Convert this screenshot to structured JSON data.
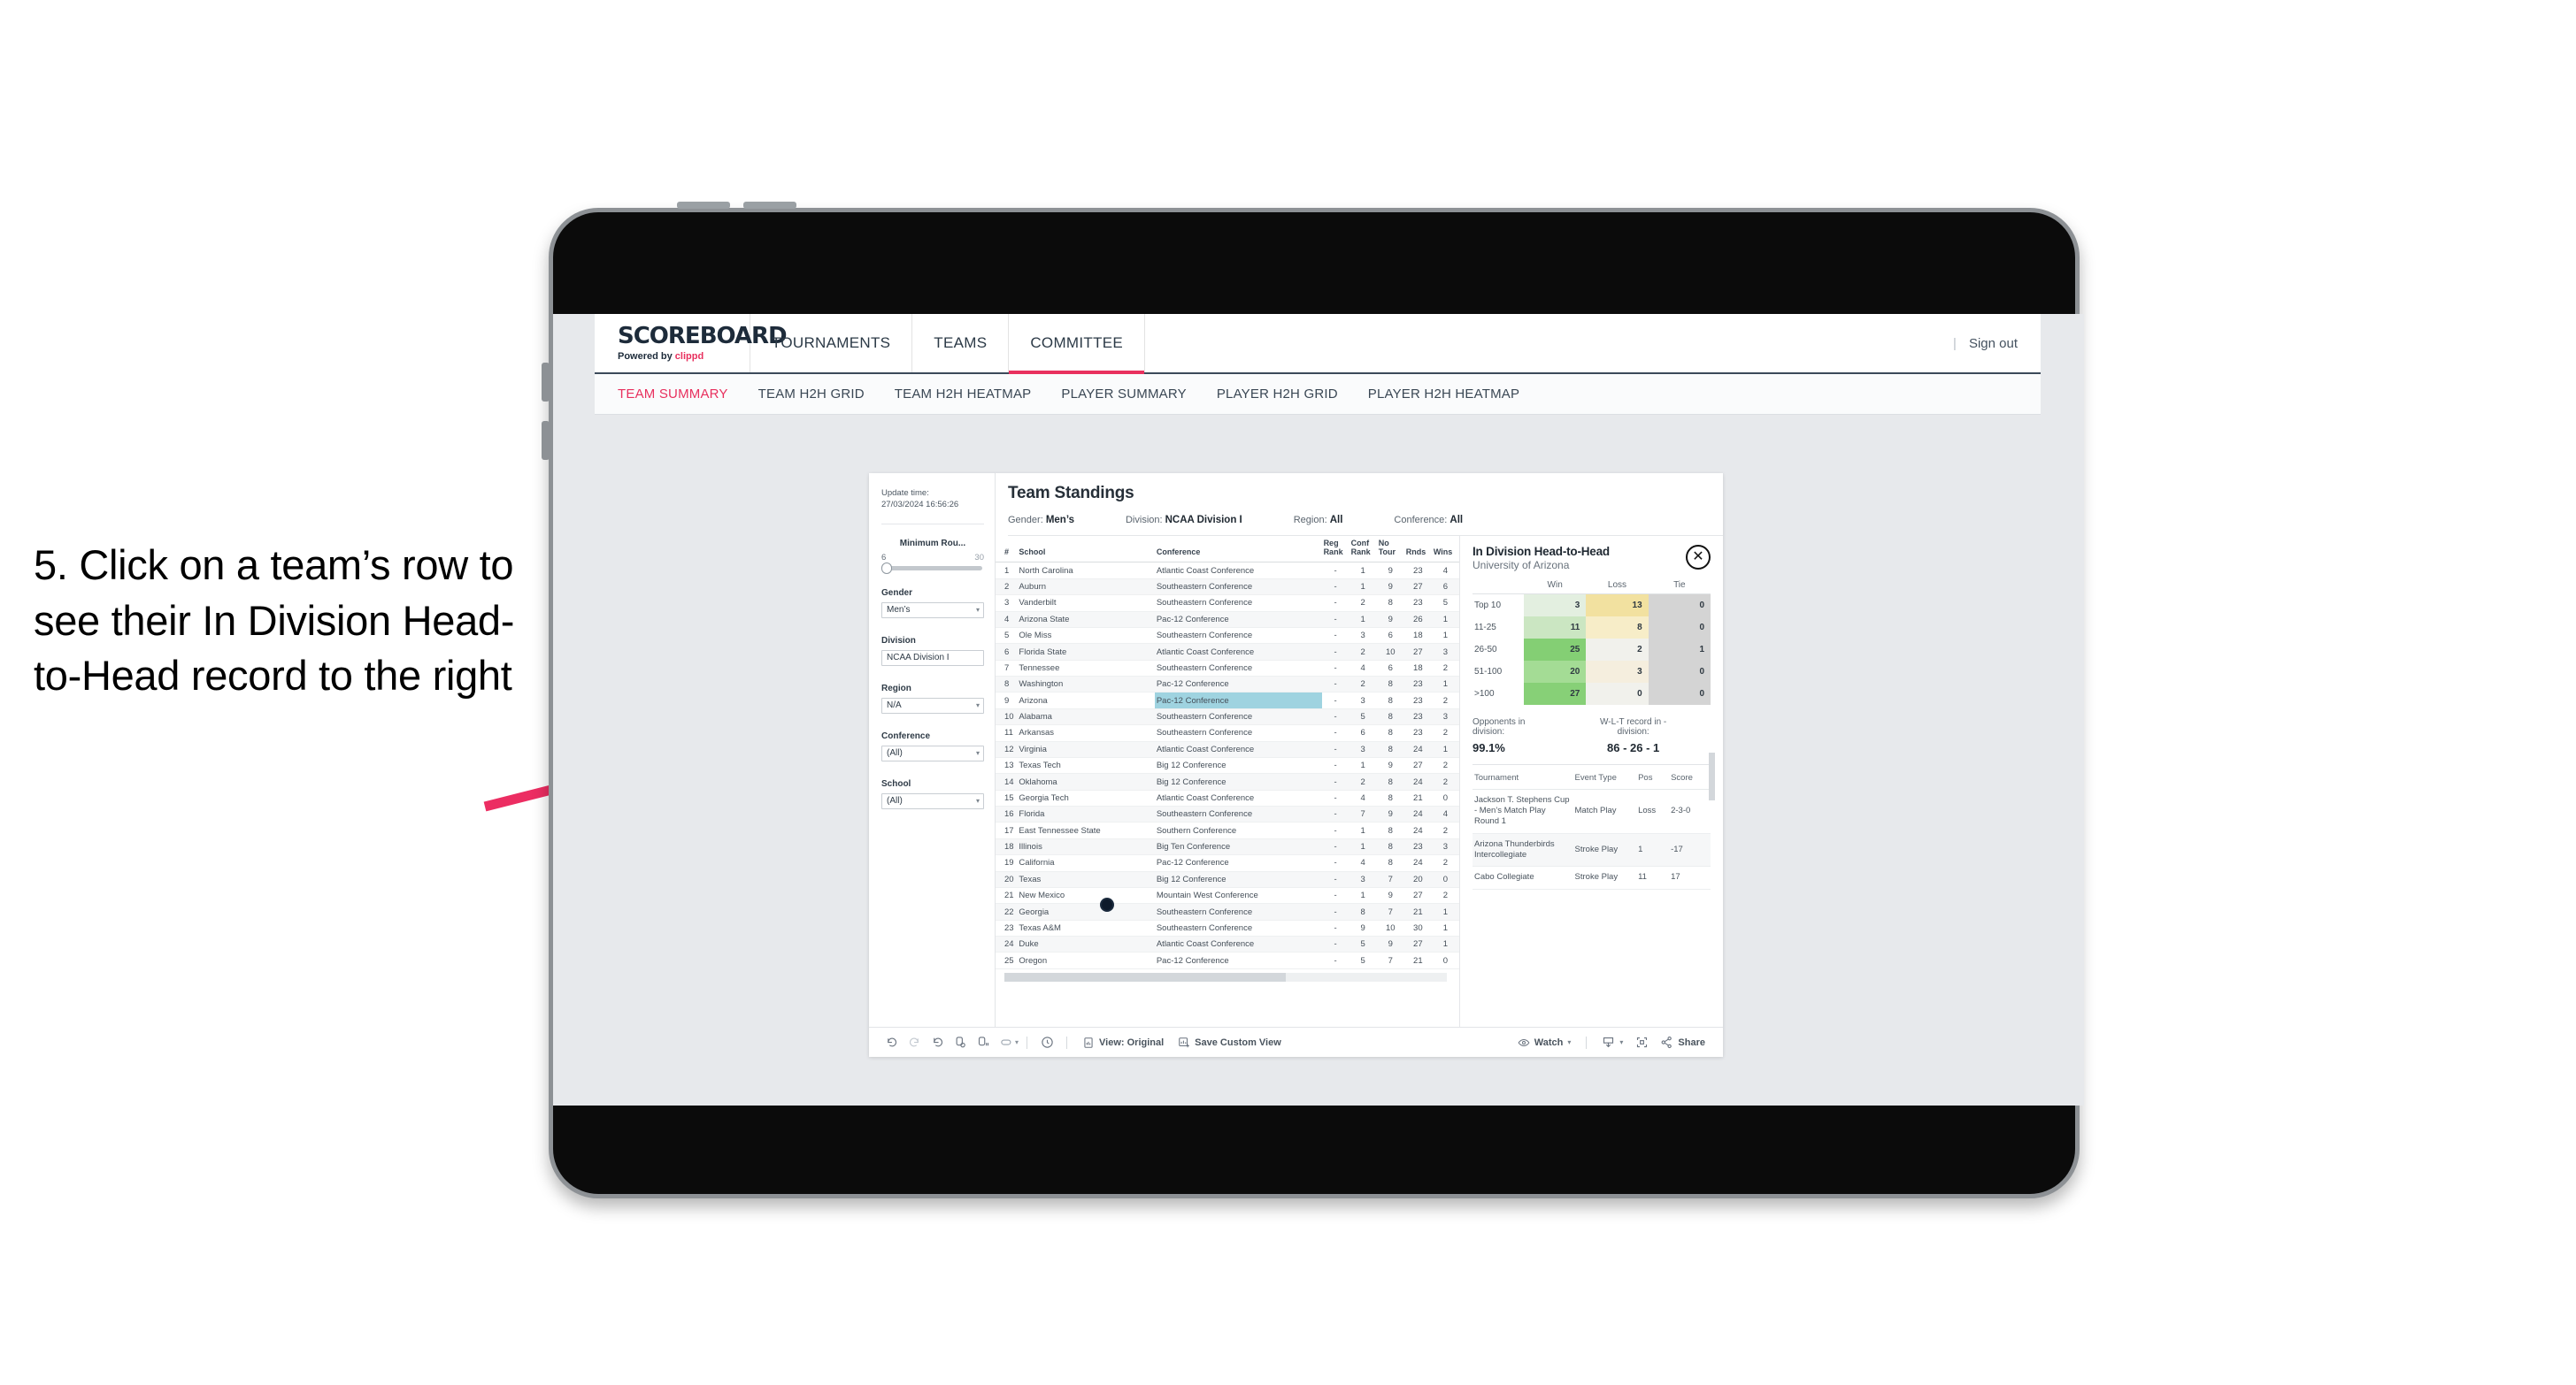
{
  "instruction": {
    "text": "5. Click on a team’s row to see their In Division Head-to-Head record to the right",
    "arrow_color": "#e8305e"
  },
  "topnav": {
    "brand_title": "SCOREBOARD",
    "brand_sub_prefix": "Powered by ",
    "brand_sub_name": "clippd",
    "items": [
      {
        "label": "TOURNAMENTS",
        "active": false
      },
      {
        "label": "TEAMS",
        "active": false
      },
      {
        "label": "COMMITTEE",
        "active": true
      }
    ],
    "divider": "|",
    "signout": "Sign out",
    "accent": "#e8305e"
  },
  "subtabs": [
    {
      "label": "TEAM SUMMARY",
      "active": true
    },
    {
      "label": "TEAM H2H GRID",
      "active": false
    },
    {
      "label": "TEAM H2H HEATMAP",
      "active": false
    },
    {
      "label": "PLAYER SUMMARY",
      "active": false
    },
    {
      "label": "PLAYER H2H GRID",
      "active": false
    },
    {
      "label": "PLAYER H2H HEATMAP",
      "active": false
    }
  ],
  "filters": {
    "update_label": "Update time:",
    "update_value": "27/03/2024 16:56:26",
    "min_rounds": {
      "label": "Minimum Rou...",
      "min": "6",
      "max": "30"
    },
    "gender": {
      "label": "Gender",
      "value": "Men’s"
    },
    "division": {
      "label": "Division",
      "value": "NCAA Division I"
    },
    "region": {
      "label": "Region",
      "value": "N/A"
    },
    "conference": {
      "label": "Conference",
      "value": "(All)"
    },
    "school": {
      "label": "School",
      "value": "(All)"
    }
  },
  "viz": {
    "title": "Team Standings",
    "filter_chips": [
      {
        "label": "Gender:",
        "value": "Men’s"
      },
      {
        "label": "Division:",
        "value": "NCAA Division I"
      },
      {
        "label": "Region:",
        "value": "All"
      },
      {
        "label": "Conference:",
        "value": "All"
      }
    ]
  },
  "standings": {
    "columns": [
      "#",
      "School",
      "Conference",
      "Reg Rank",
      "Conf Rank",
      "No Tour",
      "Rnds",
      "Wins"
    ],
    "selected_row": 9,
    "rows": [
      {
        "n": "1",
        "school": "North Carolina",
        "conf": "Atlantic Coast Conference",
        "reg": "-",
        "cr": "1",
        "nt": "9",
        "rnds": "23",
        "wins": "4"
      },
      {
        "n": "2",
        "school": "Auburn",
        "conf": "Southeastern Conference",
        "reg": "-",
        "cr": "1",
        "nt": "9",
        "rnds": "27",
        "wins": "6"
      },
      {
        "n": "3",
        "school": "Vanderbilt",
        "conf": "Southeastern Conference",
        "reg": "-",
        "cr": "2",
        "nt": "8",
        "rnds": "23",
        "wins": "5"
      },
      {
        "n": "4",
        "school": "Arizona State",
        "conf": "Pac-12 Conference",
        "reg": "-",
        "cr": "1",
        "nt": "9",
        "rnds": "26",
        "wins": "1"
      },
      {
        "n": "5",
        "school": "Ole Miss",
        "conf": "Southeastern Conference",
        "reg": "-",
        "cr": "3",
        "nt": "6",
        "rnds": "18",
        "wins": "1"
      },
      {
        "n": "6",
        "school": "Florida State",
        "conf": "Atlantic Coast Conference",
        "reg": "-",
        "cr": "2",
        "nt": "10",
        "rnds": "27",
        "wins": "3"
      },
      {
        "n": "7",
        "school": "Tennessee",
        "conf": "Southeastern Conference",
        "reg": "-",
        "cr": "4",
        "nt": "6",
        "rnds": "18",
        "wins": "2"
      },
      {
        "n": "8",
        "school": "Washington",
        "conf": "Pac-12 Conference",
        "reg": "-",
        "cr": "2",
        "nt": "8",
        "rnds": "23",
        "wins": "1"
      },
      {
        "n": "9",
        "school": "Arizona",
        "conf": "Pac-12 Conference",
        "reg": "-",
        "cr": "3",
        "nt": "8",
        "rnds": "23",
        "wins": "2"
      },
      {
        "n": "10",
        "school": "Alabama",
        "conf": "Southeastern Conference",
        "reg": "-",
        "cr": "5",
        "nt": "8",
        "rnds": "23",
        "wins": "3"
      },
      {
        "n": "11",
        "school": "Arkansas",
        "conf": "Southeastern Conference",
        "reg": "-",
        "cr": "6",
        "nt": "8",
        "rnds": "23",
        "wins": "2"
      },
      {
        "n": "12",
        "school": "Virginia",
        "conf": "Atlantic Coast Conference",
        "reg": "-",
        "cr": "3",
        "nt": "8",
        "rnds": "24",
        "wins": "1"
      },
      {
        "n": "13",
        "school": "Texas Tech",
        "conf": "Big 12 Conference",
        "reg": "-",
        "cr": "1",
        "nt": "9",
        "rnds": "27",
        "wins": "2"
      },
      {
        "n": "14",
        "school": "Oklahoma",
        "conf": "Big 12 Conference",
        "reg": "-",
        "cr": "2",
        "nt": "8",
        "rnds": "24",
        "wins": "2"
      },
      {
        "n": "15",
        "school": "Georgia Tech",
        "conf": "Atlantic Coast Conference",
        "reg": "-",
        "cr": "4",
        "nt": "8",
        "rnds": "21",
        "wins": "0"
      },
      {
        "n": "16",
        "school": "Florida",
        "conf": "Southeastern Conference",
        "reg": "-",
        "cr": "7",
        "nt": "9",
        "rnds": "24",
        "wins": "4"
      },
      {
        "n": "17",
        "school": "East Tennessee State",
        "conf": "Southern Conference",
        "reg": "-",
        "cr": "1",
        "nt": "8",
        "rnds": "24",
        "wins": "2"
      },
      {
        "n": "18",
        "school": "Illinois",
        "conf": "Big Ten Conference",
        "reg": "-",
        "cr": "1",
        "nt": "8",
        "rnds": "23",
        "wins": "3"
      },
      {
        "n": "19",
        "school": "California",
        "conf": "Pac-12 Conference",
        "reg": "-",
        "cr": "4",
        "nt": "8",
        "rnds": "24",
        "wins": "2"
      },
      {
        "n": "20",
        "school": "Texas",
        "conf": "Big 12 Conference",
        "reg": "-",
        "cr": "3",
        "nt": "7",
        "rnds": "20",
        "wins": "0"
      },
      {
        "n": "21",
        "school": "New Mexico",
        "conf": "Mountain West Conference",
        "reg": "-",
        "cr": "1",
        "nt": "9",
        "rnds": "27",
        "wins": "2"
      },
      {
        "n": "22",
        "school": "Georgia",
        "conf": "Southeastern Conference",
        "reg": "-",
        "cr": "8",
        "nt": "7",
        "rnds": "21",
        "wins": "1"
      },
      {
        "n": "23",
        "school": "Texas A&M",
        "conf": "Southeastern Conference",
        "reg": "-",
        "cr": "9",
        "nt": "10",
        "rnds": "30",
        "wins": "1"
      },
      {
        "n": "24",
        "school": "Duke",
        "conf": "Atlantic Coast Conference",
        "reg": "-",
        "cr": "5",
        "nt": "9",
        "rnds": "27",
        "wins": "1"
      },
      {
        "n": "25",
        "school": "Oregon",
        "conf": "Pac-12 Conference",
        "reg": "-",
        "cr": "5",
        "nt": "7",
        "rnds": "21",
        "wins": "0"
      }
    ]
  },
  "h2h": {
    "title": "In Division Head-to-Head",
    "subtitle": "University of Arizona",
    "close_icon": "close-icon",
    "grid": {
      "columns": [
        "Win",
        "Loss",
        "Tie"
      ],
      "rows": [
        {
          "label": "Top 10",
          "win": "3",
          "loss": "13",
          "tie": "0",
          "win_color": "#e3efe0",
          "loss_color": "#f2e1a0",
          "tie_color": "#d4d4d4"
        },
        {
          "label": "11-25",
          "win": "11",
          "loss": "8",
          "tie": "0",
          "win_color": "#cbe6c2",
          "loss_color": "#f7edc8",
          "tie_color": "#d4d4d4"
        },
        {
          "label": "26-50",
          "win": "25",
          "loss": "2",
          "tie": "1",
          "win_color": "#84cf74",
          "loss_color": "#f1f1ec",
          "tie_color": "#d4d4d4"
        },
        {
          "label": "51-100",
          "win": "20",
          "loss": "3",
          "tie": "0",
          "win_color": "#a4dc95",
          "loss_color": "#f5eede",
          "tie_color": "#d4d4d4"
        },
        {
          "label": ">100",
          "win": "27",
          "loss": "0",
          "tie": "0",
          "win_color": "#87d077",
          "loss_color": "#f1f1ec",
          "tie_color": "#d4d4d4"
        }
      ]
    },
    "stats": [
      {
        "label": "Opponents in division:",
        "value": "99.1%"
      },
      {
        "label": "W-L-T record in -division:",
        "value": "86 - 26 - 1"
      }
    ],
    "tournaments": {
      "columns": [
        "Tournament",
        "Event Type",
        "Pos",
        "Score"
      ],
      "rows": [
        {
          "tournament": "Jackson T. Stephens Cup - Men’s Match Play Round 1",
          "event": "Match Play",
          "pos": "Loss",
          "score": "2-3-0"
        },
        {
          "tournament": "Arizona Thunderbirds Intercollegiate",
          "event": "Stroke Play",
          "pos": "1",
          "score": "-17"
        },
        {
          "tournament": "Cabo Collegiate",
          "event": "Stroke Play",
          "pos": "11",
          "score": "17"
        }
      ]
    }
  },
  "toolbar": {
    "icons": [
      "undo-icon",
      "redo-icon",
      "revert-icon",
      "refresh-data-icon",
      "pause-updates-icon",
      "device-layout-icon"
    ],
    "clock_icon": "clock-icon",
    "view_label": "View: Original",
    "save_label": "Save Custom View",
    "watch_label": "Watch",
    "share_label": "Share",
    "download_icon": "download-icon",
    "fullscreen_icon": "fullscreen-icon"
  }
}
